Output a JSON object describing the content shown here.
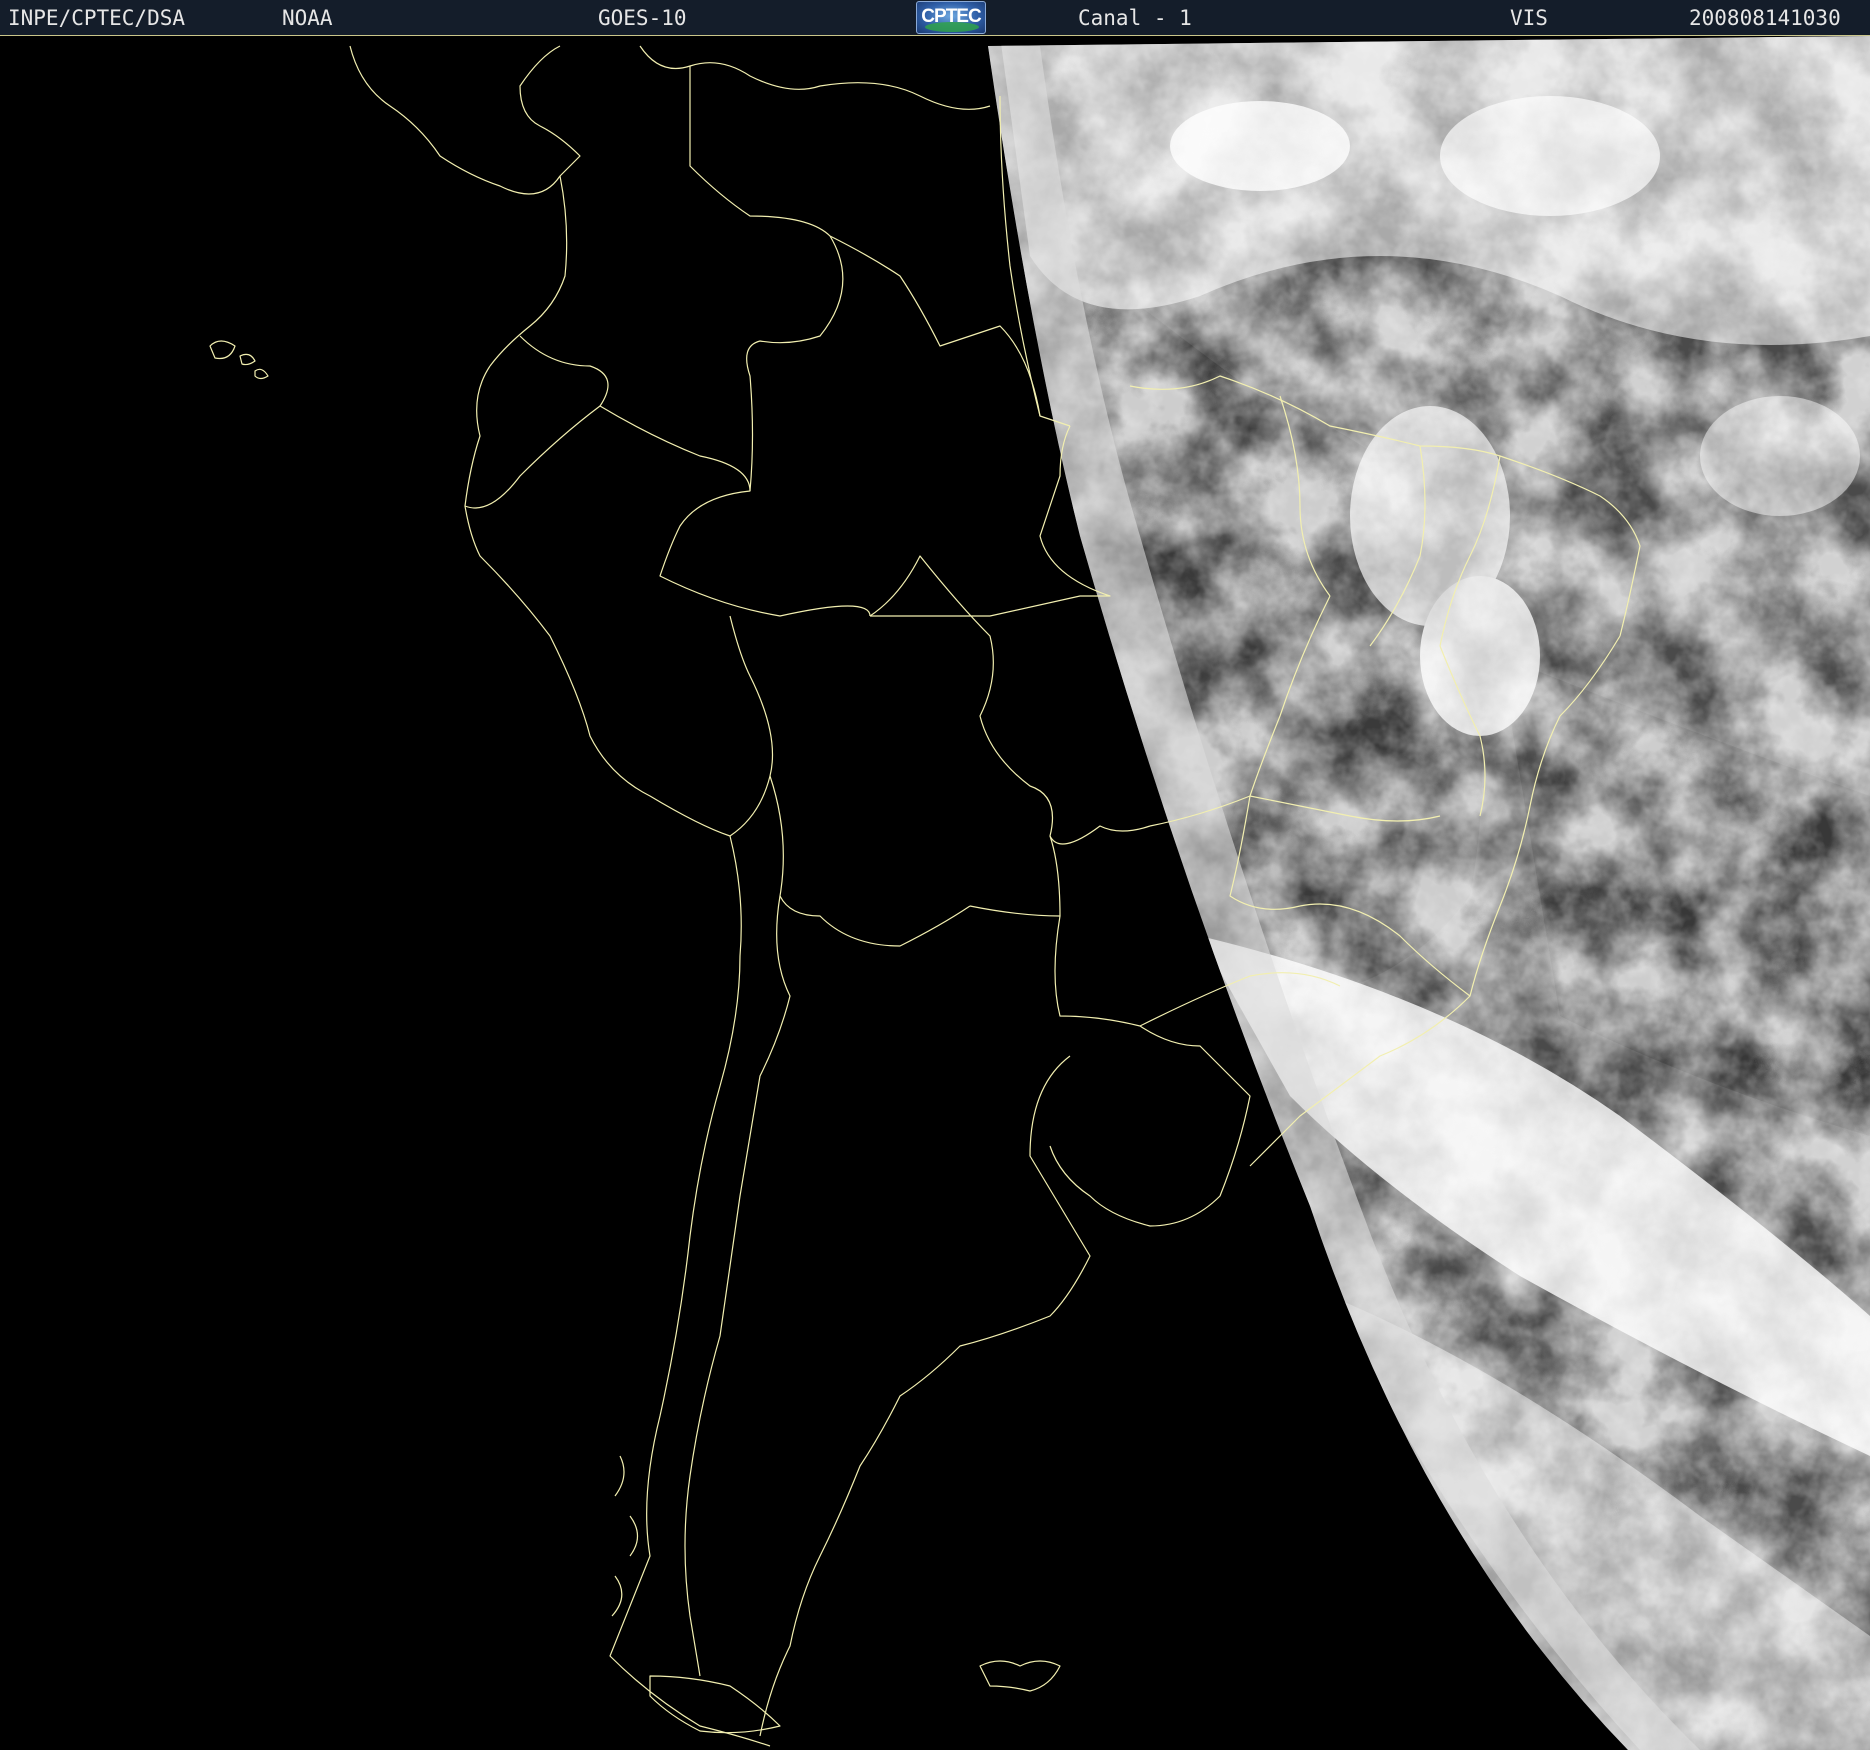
{
  "header": {
    "institution": "INPE/CPTEC/DSA",
    "agency": "NOAA",
    "satellite": "GOES-10",
    "logo_text": "CPTEC",
    "channel": "Canal - 1",
    "band": "VIS",
    "timestamp": "200808141030"
  },
  "colors": {
    "header_bg": "#141d2a",
    "header_text": "#e6e6e6",
    "map_bg": "#000000",
    "boundary_line": "#f2efb0"
  },
  "map": {
    "region": "South America",
    "imagery": "visible satellite, western half in night (black), eastern half sunlit with clouds"
  }
}
